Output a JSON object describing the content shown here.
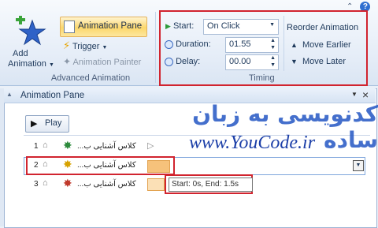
{
  "ribbon": {
    "add_animation": {
      "line1": "Add",
      "line2": "Animation",
      "icon": "star-plus-icon"
    },
    "animation_pane_button": "Animation Pane",
    "trigger_button": "Trigger",
    "animation_painter_button": "Animation Painter",
    "group_label": "Advanced Animation",
    "timing": {
      "start_label": "Start:",
      "start_value": "On Click",
      "duration_label": "Duration:",
      "duration_value": "01.55",
      "delay_label": "Delay:",
      "delay_value": "00.00",
      "group_label": "Timing"
    },
    "reorder": {
      "title": "Reorder Animation",
      "move_earlier": "Move Earlier",
      "move_later": "Move Later"
    }
  },
  "pane": {
    "title": "Animation Pane",
    "play_button": "Play",
    "items": [
      {
        "number": "1",
        "text": "...کلاس آشنایی ب",
        "color": "#2e8b3d"
      },
      {
        "number": "2",
        "text": "...کلاس آشنایی ب",
        "color": "#d7a200"
      },
      {
        "number": "3",
        "text": "...کلاس آشنایی ب",
        "color": "#c0392b"
      }
    ],
    "tooltip": "Start: 0s, End: 1.5s"
  },
  "watermark": {
    "line1": "کدنویسی به زبان ساده",
    "line2": "www.YouCode.ir"
  },
  "colors": {
    "highlight_red": "#d1242f",
    "accent_blue": "#1e395b"
  }
}
